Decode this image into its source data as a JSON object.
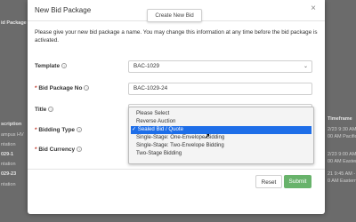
{
  "background": {
    "left": [
      {
        "text": "id Package",
        "bold": true
      },
      {
        "text": "scription",
        "bold": true
      },
      {
        "text": "ampus HV",
        "bold": false
      },
      {
        "text": "ntation",
        "bold": false
      },
      {
        "text": "029-1",
        "bold": true
      },
      {
        "text": "ntation",
        "bold": false
      },
      {
        "text": "029-23",
        "bold": true
      },
      {
        "text": "ntation",
        "bold": false
      }
    ],
    "right": [
      {
        "text": "Timeframe",
        "bold": true
      },
      {
        "text": "2/23 9:30 AM - 5",
        "bold": false
      },
      {
        "text": "00 AM Pacific Ti",
        "bold": false
      },
      {
        "text": "2/23 9:00 AM -",
        "bold": false
      },
      {
        "text": "00 AM Eastern",
        "bold": false
      },
      {
        "text": "21 9:45 AM - 9/",
        "bold": false
      },
      {
        "text": "0 AM Eastern",
        "bold": false
      }
    ]
  },
  "modal": {
    "title": "New Bid Package",
    "close_glyph": "×",
    "tooltip": "Create New Bid",
    "intro": "Please give your new bid package a name. You may change this information at any time before the bid package is activated.",
    "fields": {
      "template": {
        "label": "Template",
        "value": "BAC-1029",
        "info": "?"
      },
      "bid_package_no": {
        "label": "Bid Package No",
        "required_mark": "*",
        "value": "BAC-1029-24",
        "info": "?"
      },
      "title": {
        "label": "Title",
        "info": "?"
      },
      "bidding_type": {
        "label": "Bidding Type",
        "required_mark": "*",
        "info": "?"
      },
      "bid_currency": {
        "label": "Bid Currency",
        "required_mark": "*",
        "info": "?"
      }
    },
    "dropdown": {
      "options": [
        "Please Select",
        "Reverse Auction",
        "✓ Sealed Bid / Quote",
        "Single-Stage: One-Envelope Bidding",
        "Single-Stage: Two-Envelope Bidding",
        "Two-Stage Bidding"
      ],
      "selected_index": 2
    },
    "buttons": {
      "reset": "Reset",
      "submit": "Submit"
    }
  },
  "colors": {
    "submit": "#68b36b",
    "selected_option": "#1e6ee8",
    "required": "#c0392b"
  }
}
